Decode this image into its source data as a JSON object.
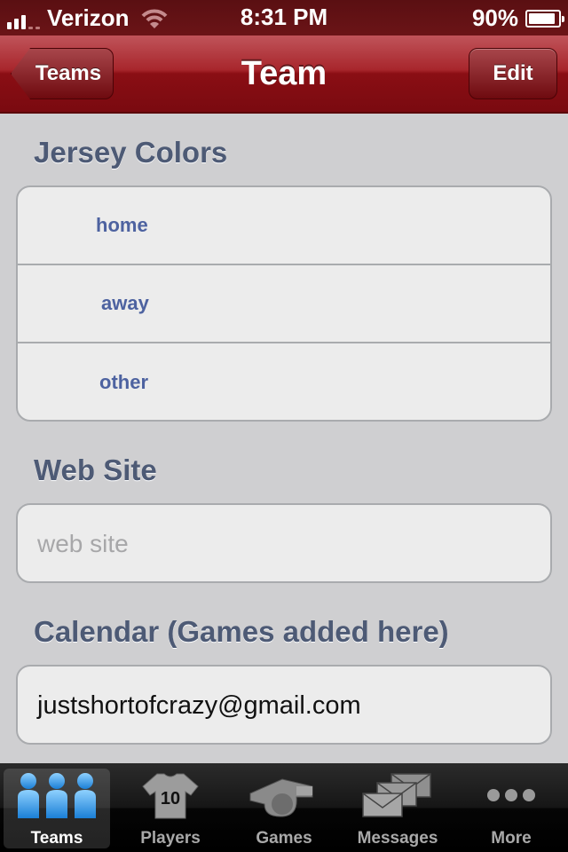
{
  "status_bar": {
    "carrier": "Verizon",
    "time": "8:31 PM",
    "battery": "90%",
    "battery_level": 0.9
  },
  "nav": {
    "back_label": "Teams",
    "title": "Team",
    "edit_label": "Edit"
  },
  "jersey": {
    "header": "Jersey Colors",
    "items": [
      {
        "label": "home"
      },
      {
        "label": "away"
      },
      {
        "label": "other"
      }
    ]
  },
  "website": {
    "header": "Web Site",
    "placeholder": "web site"
  },
  "calendar": {
    "header": "Calendar (Games added here)",
    "value": "justshortofcrazy@gmail.com"
  },
  "tabs": [
    {
      "label": "Teams",
      "icon": "teams-icon",
      "active": true
    },
    {
      "label": "Players",
      "icon": "jersey-icon",
      "jersey_number": "10"
    },
    {
      "label": "Games",
      "icon": "whistle-icon"
    },
    {
      "label": "Messages",
      "icon": "envelopes-icon"
    },
    {
      "label": "More",
      "icon": "more-icon"
    }
  ],
  "colors": {
    "nav_red": "#8a0e14",
    "section_header": "#4d5a75",
    "jersey_label": "#4d62a0"
  }
}
